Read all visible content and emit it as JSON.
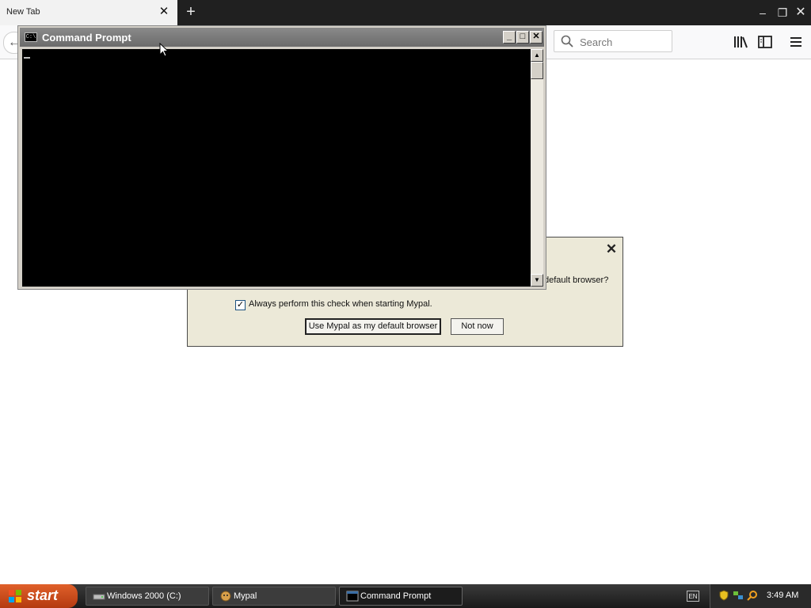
{
  "browser": {
    "tab": {
      "title": "New Tab",
      "close_glyph": "✕"
    },
    "new_tab_glyph": "+",
    "window_controls": {
      "minimize": "–",
      "restore": "❐",
      "close": "✕"
    },
    "back_glyph": "←",
    "search": {
      "placeholder": "Search"
    },
    "toolbar_icons": [
      "library-icon",
      "sidebar-icon",
      "menu-icon"
    ]
  },
  "dialog": {
    "close_glyph": "✕",
    "question_text": "default browser?",
    "checkbox": {
      "checked": true,
      "label": "Always perform this check when starting Mypal."
    },
    "buttons": {
      "primary": "Use Mypal as my default browser",
      "secondary": "Not now"
    }
  },
  "cmd_window": {
    "title": "Command Prompt",
    "icon_text": "C:\\",
    "controls": {
      "minimize": "_",
      "maximize": "□",
      "close": "✕"
    },
    "scroll_up": "▲",
    "scroll_down": "▼"
  },
  "taskbar": {
    "start_label": "start",
    "tasks": [
      {
        "label": "Windows 2000 (C:)",
        "icon": "drive-icon",
        "active": false
      },
      {
        "label": "Mypal",
        "icon": "mypal-icon",
        "active": false
      },
      {
        "label": "Command Prompt",
        "icon": "cmd-icon",
        "active": true
      }
    ],
    "lang": "EN",
    "clock": "3:49 AM"
  }
}
